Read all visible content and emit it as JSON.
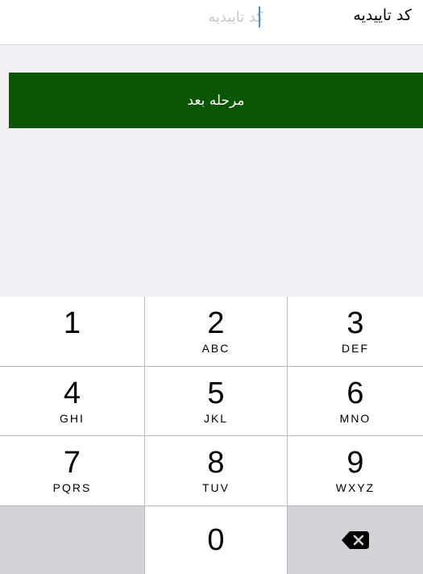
{
  "form": {
    "label": "کد تاییدیه",
    "input_value": "",
    "input_placeholder": "کد تاییدیه"
  },
  "next_button": {
    "label": "مرحله بعد",
    "color": "#0b5605"
  },
  "keypad": {
    "keys": [
      {
        "digit": "1",
        "letters": ""
      },
      {
        "digit": "2",
        "letters": "ABC"
      },
      {
        "digit": "3",
        "letters": "DEF"
      },
      {
        "digit": "4",
        "letters": "GHI"
      },
      {
        "digit": "5",
        "letters": "JKL"
      },
      {
        "digit": "6",
        "letters": "MNO"
      },
      {
        "digit": "7",
        "letters": "PQRS"
      },
      {
        "digit": "8",
        "letters": "TUV"
      },
      {
        "digit": "9",
        "letters": "WXYZ"
      },
      {
        "digit": "0",
        "letters": ""
      }
    ],
    "delete_icon": "backspace-icon"
  }
}
